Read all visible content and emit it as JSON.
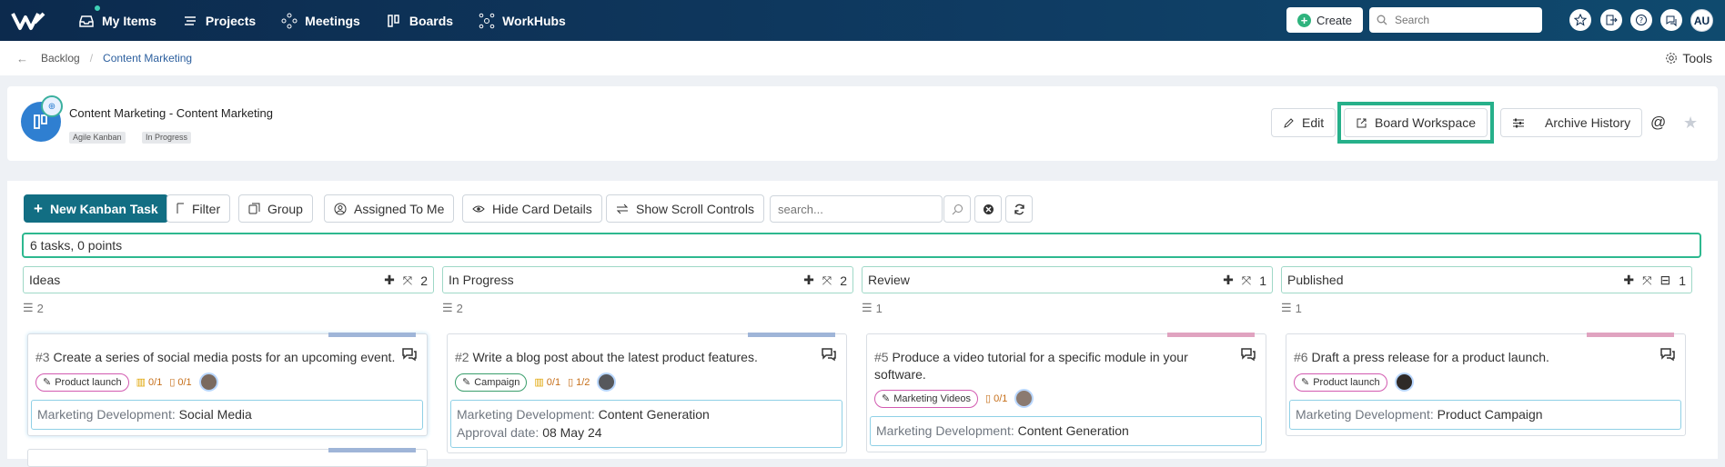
{
  "nav": {
    "items": [
      {
        "label": "My Items",
        "icon": "inbox-icon"
      },
      {
        "label": "Projects",
        "icon": "projects-icon"
      },
      {
        "label": "Meetings",
        "icon": "meetings-icon"
      },
      {
        "label": "Boards",
        "icon": "boards-icon"
      },
      {
        "label": "WorkHubs",
        "icon": "workhubs-icon"
      }
    ],
    "create_label": "Create",
    "search_placeholder": "Search",
    "user_initials": "AU"
  },
  "breadcrumb": {
    "parent": "Backlog",
    "current": "Content Marketing",
    "tools_label": "Tools"
  },
  "project": {
    "title": "Content Marketing - Content Marketing",
    "tags": [
      "Agile Kanban",
      "In Progress"
    ],
    "edit_label": "Edit",
    "board_workspace_label": "Board Workspace",
    "archive_history_label": "Archive History",
    "at_symbol": "@"
  },
  "toolbar": {
    "new_task_label": "New Kanban Task",
    "filter_label": "Filter",
    "group_label": "Group",
    "assigned_label": "Assigned To Me",
    "hide_details_label": "Hide Card Details",
    "scroll_controls_label": "Show Scroll Controls",
    "search_placeholder": "search..."
  },
  "summary": "6 tasks, 0 points",
  "columns": [
    {
      "name": "Ideas",
      "count": "2",
      "stack_count": "2"
    },
    {
      "name": "In Progress",
      "count": "2",
      "stack_count": "2"
    },
    {
      "name": "Review",
      "count": "1",
      "stack_count": "1"
    },
    {
      "name": "Published",
      "count": "1",
      "stack_count": "1"
    }
  ],
  "cards": [
    {
      "num": "#3",
      "title": "Create a series of social media posts for an upcoming event.",
      "tag": "Product launch",
      "m1": "0/1",
      "m2": "0/1",
      "field_label": "Marketing Development:",
      "field_value": "Social Media",
      "stripe": "#9fb5d8"
    },
    {
      "num": "#2",
      "title": "Write a blog post about the latest product features.",
      "tag": "Campaign",
      "m1": "0/1",
      "m2": "1/2",
      "field_label": "Marketing Development:",
      "field_value": "Content Generation",
      "approval_label": "Approval date:",
      "approval_value": "08 May 24",
      "stripe": "#9fb5d8"
    },
    {
      "num": "#5",
      "title_line1": "Produce a video tutorial for a specific module in your",
      "title_line2": "software.",
      "tag": "Marketing Videos",
      "m2": "0/1",
      "field_label": "Marketing Development:",
      "field_value": "Content Generation",
      "stripe": "#e0a3c0"
    },
    {
      "num": "#6",
      "title": "Draft a press release for a product launch.",
      "tag": "Product launch",
      "field_label": "Marketing Development:",
      "field_value": "Product Campaign",
      "stripe": "#e0a3c0"
    }
  ]
}
